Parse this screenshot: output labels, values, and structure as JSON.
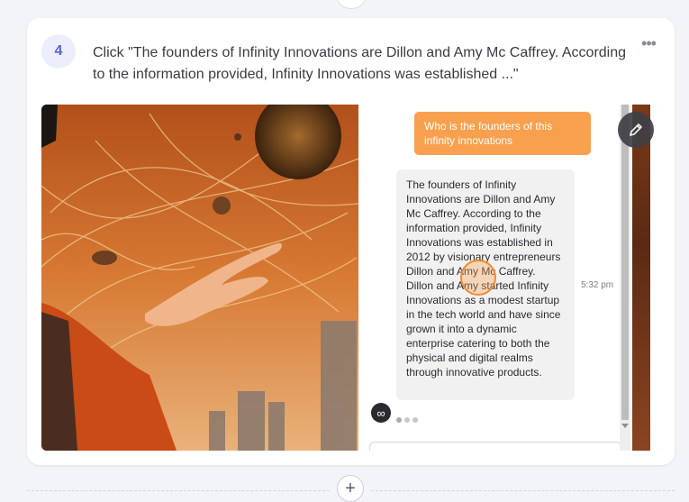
{
  "step": {
    "number": "4",
    "instruction": "Click \"The founders of Infinity Innovations are Dillon and Amy Mc Caffrey. According to the information provided, Infinity Innovations was established ...\"",
    "menu_icon": "more-horizontal-icon"
  },
  "chat": {
    "user_message": "Who is the founders of this infinity innovations",
    "bot_message": "The founders of Infinity Innovations are Dillon and Amy Mc Caffrey. According to the information provided, Infinity Innovations was established in 2012 by visionary entrepreneurs Dillon and Amy Mc Caffrey. Dillon and Amy started Infinity Innovations as a modest startup in the tech world and have since grown it into a dynamic enterprise catering to both the physical and digital realms through innovative products.",
    "timestamp": "5:32 pm",
    "bot_avatar_glyph": "∞"
  },
  "colors": {
    "accent": "#f9a04e",
    "badge_text": "#5a63d8",
    "badge_bg": "#eceefb"
  },
  "icons": {
    "edit": "pencil-icon",
    "add": "plus-icon"
  },
  "add_label": "+"
}
